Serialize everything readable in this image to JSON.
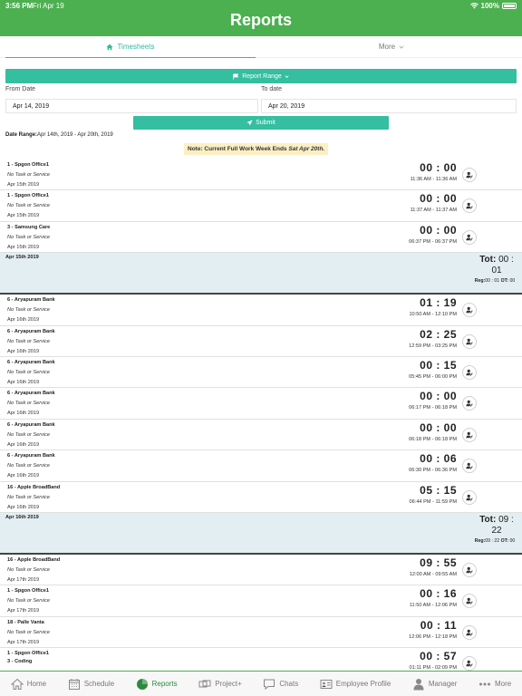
{
  "status": {
    "time": "3:56 PM",
    "date": "Fri Apr 19",
    "battery": "100%"
  },
  "header": {
    "title": "Reports"
  },
  "tabs": [
    {
      "label": "Timesheets",
      "icon": "home-icon",
      "active": true
    },
    {
      "label": "More",
      "icon": "chevron-down-icon",
      "active": false
    }
  ],
  "filter": {
    "range_button": "Report Range",
    "from_label": "From Date",
    "to_label": "To date",
    "from_value": "Apr 14, 2019",
    "to_value": "Apr 20, 2019",
    "submit": "Submit",
    "date_range_label": "Date Range:",
    "date_range_value": "Apr 14th, 2019 - Apr 20th, 2019",
    "note_prefix": "Note: Current Full Work Week Ends ",
    "note_emphasis": "Sat Apr 20th."
  },
  "groups": [
    {
      "entries": [
        {
          "name": "1 - Spgon Office1",
          "task": "No Task or Service",
          "date": "Apr 15th 2019",
          "duration": "00 : 00",
          "range": "11:36 AM - 11:36 AM"
        },
        {
          "name": "1 - Spgon Office1",
          "task": "No Task or Service",
          "date": "Apr 15th 2019",
          "duration": "00 : 00",
          "range": "11:37 AM - 11:37 AM"
        },
        {
          "name": "3 - Samsung Care",
          "task": "No Task or Service",
          "date": "Apr 15th 2019",
          "duration": "00 : 00",
          "range": "06:37 PM - 06:37 PM"
        }
      ],
      "summary": {
        "date": "Apr 15th 2019",
        "tot_label": "Tot:",
        "tot_value": "00 : 01",
        "reg_label": "Reg:",
        "reg_value": "00 : 01",
        "ot_label": "OT:",
        "ot_value": "00"
      }
    },
    {
      "entries": [
        {
          "name": "6 - Aryapuram Bank",
          "task": "No Task or Service",
          "date": "Apr 16th 2019",
          "duration": "01 : 19",
          "range": "10:50 AM - 12:10 PM"
        },
        {
          "name": "6 - Aryapuram Bank",
          "task": "No Task or Service",
          "date": "Apr 16th 2019",
          "duration": "02 : 25",
          "range": "12:59 PM - 03:25 PM"
        },
        {
          "name": "6 - Aryapuram Bank",
          "task": "No Task or Service",
          "date": "Apr 16th 2019",
          "duration": "00 : 15",
          "range": "05:45 PM - 06:00 PM"
        },
        {
          "name": "6 - Aryapuram Bank",
          "task": "No Task or Service",
          "date": "Apr 16th 2019",
          "duration": "00 : 00",
          "range": "06:17 PM - 06:18 PM"
        },
        {
          "name": "6 - Aryapuram Bank",
          "task": "No Task or Service",
          "date": "Apr 16th 2019",
          "duration": "00 : 00",
          "range": "06:18 PM - 06:18 PM"
        },
        {
          "name": "6 - Aryapuram Bank",
          "task": "No Task or Service",
          "date": "Apr 16th 2019",
          "duration": "00 : 06",
          "range": "06:30 PM - 06:36 PM"
        },
        {
          "name": "16 - Apple BroadBand",
          "task": "No Task or Service",
          "date": "Apr 16th 2019",
          "duration": "05 : 15",
          "range": "06:44 PM - 11:59 PM"
        }
      ],
      "summary": {
        "date": "Apr 16th 2019",
        "tot_label": "Tot:",
        "tot_value": "09 : 22",
        "reg_label": "Reg:",
        "reg_value": "09 : 22",
        "ot_label": "OT:",
        "ot_value": "00"
      }
    },
    {
      "entries": [
        {
          "name": "16 - Apple BroadBand",
          "task": "No Task or Service",
          "date": "Apr 17th 2019",
          "duration": "09 : 55",
          "range": "12:00 AM - 09:55 AM"
        },
        {
          "name": "1 - Spgon Office1",
          "task": "No Task or Service",
          "date": "Apr 17th 2019",
          "duration": "00 : 16",
          "range": "11:50 AM - 12:06 PM"
        },
        {
          "name": "18 - Palle Vanta",
          "task": "No Task or Service",
          "date": "Apr 17th 2019",
          "duration": "00 : 11",
          "range": "12:06 PM - 12:18 PM"
        },
        {
          "name": "1 - Spgon Office1",
          "name2": "3 - Coding",
          "task": "",
          "date": "",
          "duration": "00 : 57",
          "range": "01:11 PM - 02:09 PM"
        }
      ]
    }
  ],
  "bottom_nav": [
    {
      "label": "Home",
      "icon": "home-icon",
      "active": false
    },
    {
      "label": "Schedule",
      "icon": "calendar-icon",
      "active": false
    },
    {
      "label": "Reports",
      "icon": "pie-chart-icon",
      "active": true
    },
    {
      "label": "Project+",
      "icon": "project-icon",
      "active": false
    },
    {
      "label": "Chats",
      "icon": "chat-icon",
      "active": false
    },
    {
      "label": "Employee Profile",
      "icon": "id-card-icon",
      "active": false
    },
    {
      "label": "Manager",
      "icon": "person-icon",
      "active": false
    },
    {
      "label": "More",
      "icon": "more-icon",
      "active": false
    }
  ]
}
